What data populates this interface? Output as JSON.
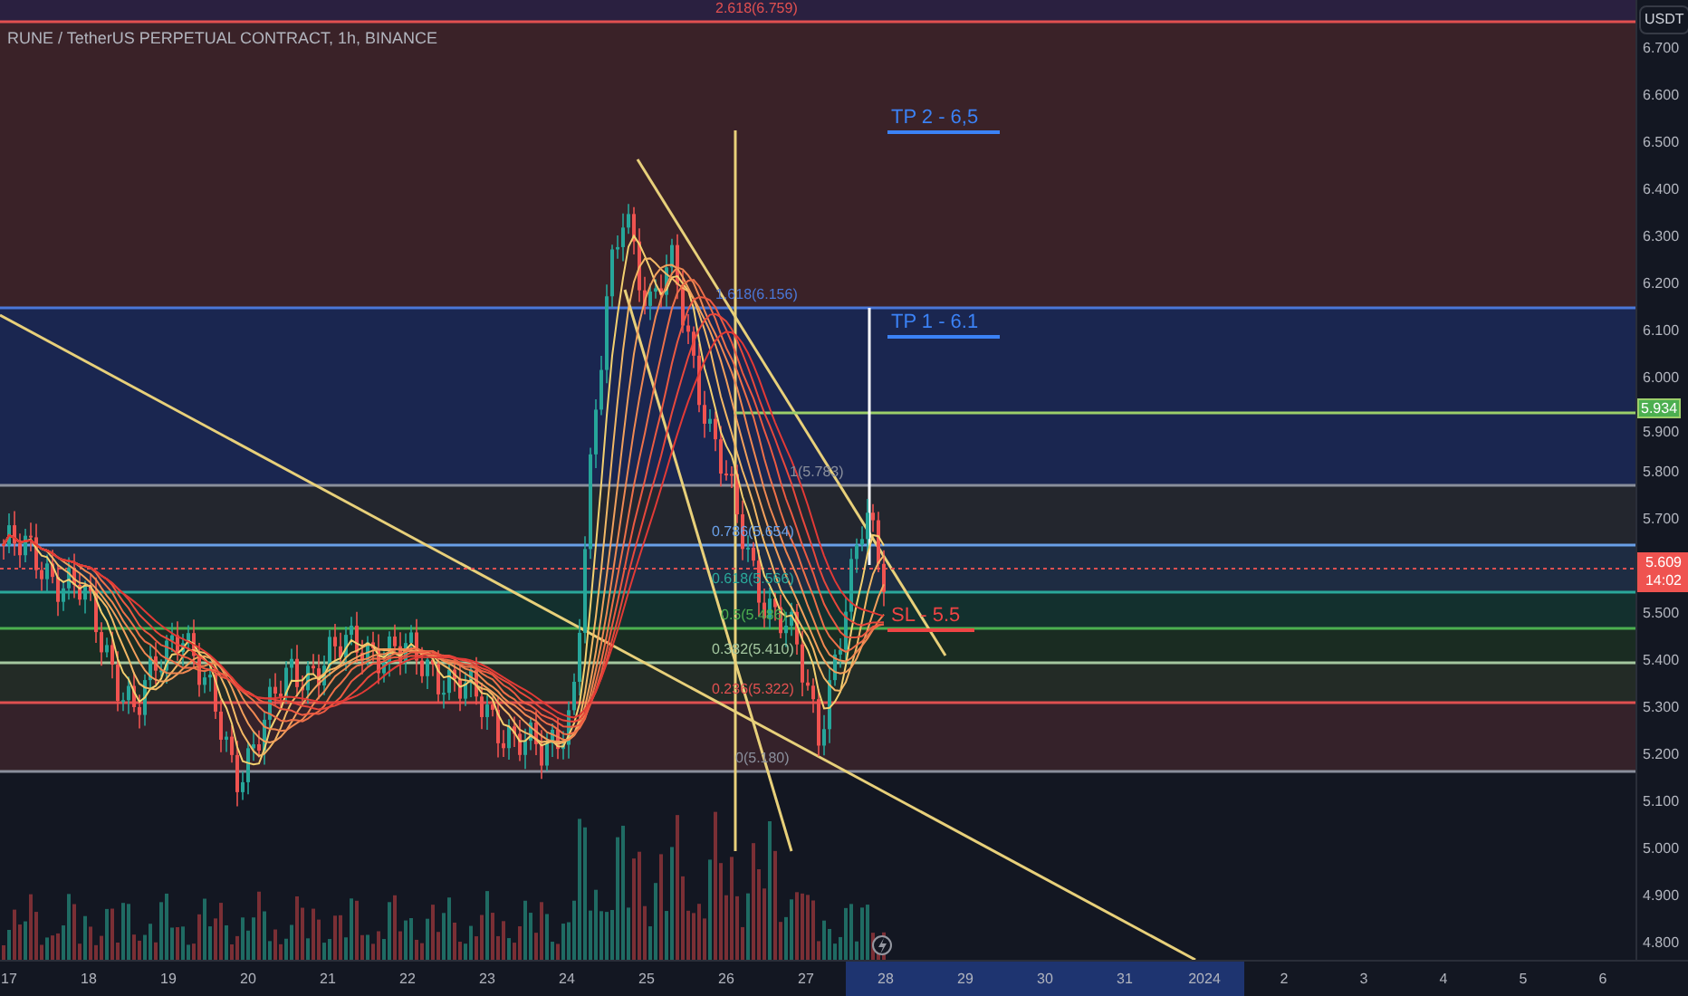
{
  "chart": {
    "title": "RUNE / TetherUS PERPETUAL CONTRACT, 1h, BINANCE",
    "fib_levels": [
      {
        "label": "2.618(6.759)",
        "color": "#e05050"
      },
      {
        "label": "1.618(6.156)",
        "color": "#4a78d8"
      },
      {
        "label": "1(5.783)",
        "color": "#8a8f9c"
      },
      {
        "label": "0.786(5.654)",
        "color": "#6aa0e8"
      },
      {
        "label": "0.618(5.566)",
        "color": "#2aa89a"
      },
      {
        "label": "0.5(5.486)",
        "color": "#4caf50"
      },
      {
        "label": "0.382(5.410)",
        "color": "#a5c8a0"
      },
      {
        "label": "0.236(5.322)",
        "color": "#e05050"
      },
      {
        "label": "0(5.180)",
        "color": "#8a8f9c"
      }
    ],
    "annotations": [
      {
        "text": "TP 2 - 6,5",
        "kind": "target"
      },
      {
        "text": "TP 1 - 6.1",
        "kind": "target"
      },
      {
        "text": "SL - 5.5",
        "kind": "stop"
      }
    ]
  },
  "price_axis": {
    "currency": "USDT",
    "ticks": [
      "6.700",
      "6.600",
      "6.500",
      "6.400",
      "6.300",
      "6.200",
      "6.100",
      "6.000",
      "5.900",
      "5.800",
      "5.700",
      "5.500",
      "5.400",
      "5.300",
      "5.200",
      "5.100",
      "5.000",
      "4.900",
      "4.800"
    ],
    "badges": [
      {
        "kind": "level",
        "text": "5.934"
      },
      {
        "kind": "last",
        "text": "5.609",
        "countdown": "14:02"
      }
    ]
  },
  "time_axis": {
    "labels": [
      {
        "text": "17",
        "selected": false
      },
      {
        "text": "18",
        "selected": false
      },
      {
        "text": "19",
        "selected": false
      },
      {
        "text": "20",
        "selected": false
      },
      {
        "text": "21",
        "selected": false
      },
      {
        "text": "22",
        "selected": false
      },
      {
        "text": "23",
        "selected": false
      },
      {
        "text": "24",
        "selected": false
      },
      {
        "text": "25",
        "selected": false
      },
      {
        "text": "26",
        "selected": false
      },
      {
        "text": "27",
        "selected": false
      },
      {
        "text": "28",
        "selected": true
      },
      {
        "text": "29",
        "selected": true
      },
      {
        "text": "30",
        "selected": true
      },
      {
        "text": "31",
        "selected": true
      },
      {
        "text": "2024",
        "selected": true
      },
      {
        "text": "2",
        "selected": false
      },
      {
        "text": "3",
        "selected": false
      },
      {
        "text": "4",
        "selected": false
      },
      {
        "text": "5",
        "selected": false
      },
      {
        "text": "6",
        "selected": false
      }
    ]
  }
}
